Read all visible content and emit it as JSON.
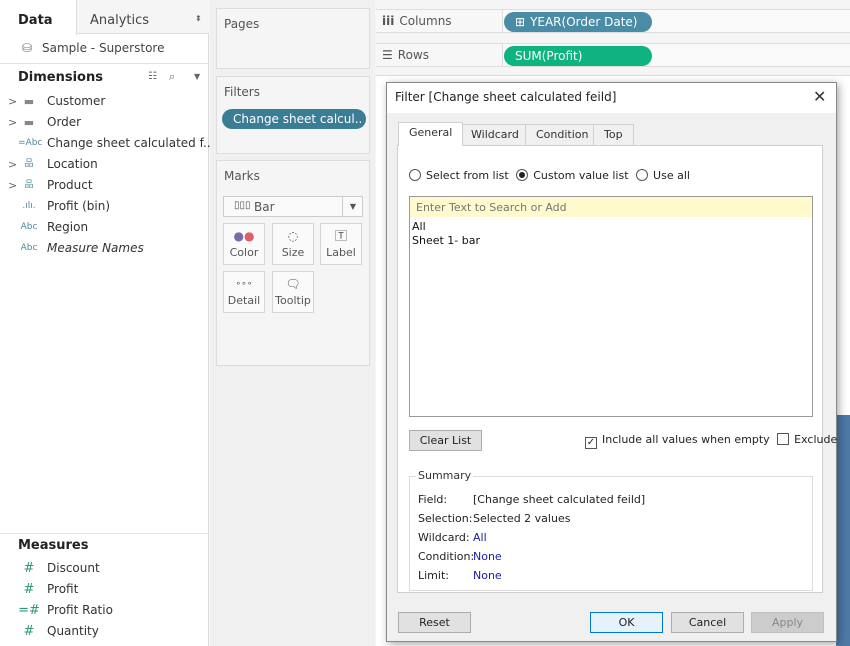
{
  "left": {
    "tabs": [
      "Data",
      "Analytics"
    ],
    "datasource": "Sample - Superstore",
    "dimensions_title": "Dimensions",
    "dimensions": [
      {
        "icon": "folder-icon",
        "glyph": "▬",
        "label": "Customer",
        "expand": true
      },
      {
        "icon": "folder-icon",
        "glyph": "▬",
        "label": "Order",
        "expand": true
      },
      {
        "icon": "calc-string-icon",
        "glyph": "=Abc",
        "label": "Change sheet calculated f...",
        "expand": false
      },
      {
        "icon": "hierarchy-icon",
        "glyph": "品",
        "label": "Location",
        "expand": true
      },
      {
        "icon": "hierarchy-icon",
        "glyph": "品",
        "label": "Product",
        "expand": true
      },
      {
        "icon": "bin-icon",
        "glyph": ".ılı.",
        "label": "Profit (bin)",
        "expand": false
      },
      {
        "icon": "string-icon",
        "glyph": "Abc",
        "label": "Region",
        "expand": false
      },
      {
        "icon": "string-icon",
        "glyph": "Abc",
        "label": "Measure Names",
        "expand": false,
        "italic": true
      }
    ],
    "measures_title": "Measures",
    "measures": [
      {
        "glyph": "#",
        "label": "Discount"
      },
      {
        "glyph": "#",
        "label": "Profit"
      },
      {
        "glyph": "=#",
        "label": "Profit Ratio"
      },
      {
        "glyph": "#",
        "label": "Quantity"
      }
    ]
  },
  "cards": {
    "pages": "Pages",
    "filters": "Filters",
    "filter_pill": "Change sheet calcul..",
    "marks": "Marks",
    "mark_type": "Bar",
    "mark_buttons": [
      "Color",
      "Size",
      "Label",
      "Detail",
      "Tooltip"
    ]
  },
  "shelves": {
    "columns": "Columns",
    "rows": "Rows",
    "columns_pill": "YEAR(Order Date)",
    "rows_pill": "SUM(Profit)"
  },
  "colors": {
    "blue_pill": "#4a8ba6",
    "green_pill": "#0fb37f",
    "filter_pill": "#3c7d96"
  },
  "dialog": {
    "title": "Filter [Change sheet calculated feild]",
    "tabs": [
      "General",
      "Wildcard",
      "Condition",
      "Top"
    ],
    "radios": [
      "Select from list",
      "Custom value list",
      "Use all"
    ],
    "selected_radio": 1,
    "search_placeholder": "Enter Text to Search or Add",
    "values": [
      "All",
      "Sheet 1- bar"
    ],
    "clear_list": "Clear List",
    "include_all": "Include all values when empty",
    "include_all_checked": true,
    "exclude": "Exclude",
    "exclude_checked": false,
    "summary": {
      "title": "Summary",
      "rows": [
        {
          "k": "Field:",
          "v": "[Change sheet calculated feild]"
        },
        {
          "k": "Selection:",
          "v": "Selected 2 values"
        },
        {
          "k": "Wildcard:",
          "v": "All"
        },
        {
          "k": "Condition:",
          "v": "None"
        },
        {
          "k": "Limit:",
          "v": "None"
        }
      ]
    },
    "buttons": {
      "reset": "Reset",
      "ok": "OK",
      "cancel": "Cancel",
      "apply": "Apply"
    }
  }
}
